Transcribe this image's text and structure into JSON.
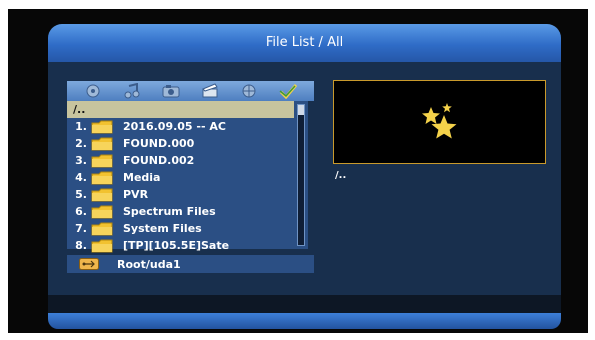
{
  "header": {
    "title": "File List / All"
  },
  "toolbar": {
    "icons": [
      "all-files-icon",
      "music-icon",
      "photo-icon",
      "video-icon",
      "record-icon",
      "favorites-icon"
    ]
  },
  "file_list": {
    "parent": "/..",
    "items": [
      {
        "num": "1.",
        "name": "2016.09.05 -- AC"
      },
      {
        "num": "2.",
        "name": "FOUND.000"
      },
      {
        "num": "3.",
        "name": "FOUND.002"
      },
      {
        "num": "4.",
        "name": "Media"
      },
      {
        "num": "5.",
        "name": "PVR"
      },
      {
        "num": "6.",
        "name": "Spectrum Files"
      },
      {
        "num": "7.",
        "name": "System Files"
      },
      {
        "num": "8.",
        "name": "[TP][105.5E]Sate"
      }
    ]
  },
  "path_bar": {
    "label": "Root/uda1"
  },
  "preview": {
    "path": "/.."
  },
  "colors": {
    "header": "#2f6cc7",
    "panel": "#182f4d",
    "list_bg": "#2b4f84",
    "selection": "#c7c49e",
    "folder": "#f2c230",
    "preview_border": "#c99a2c",
    "stars": "#f4d24a"
  }
}
